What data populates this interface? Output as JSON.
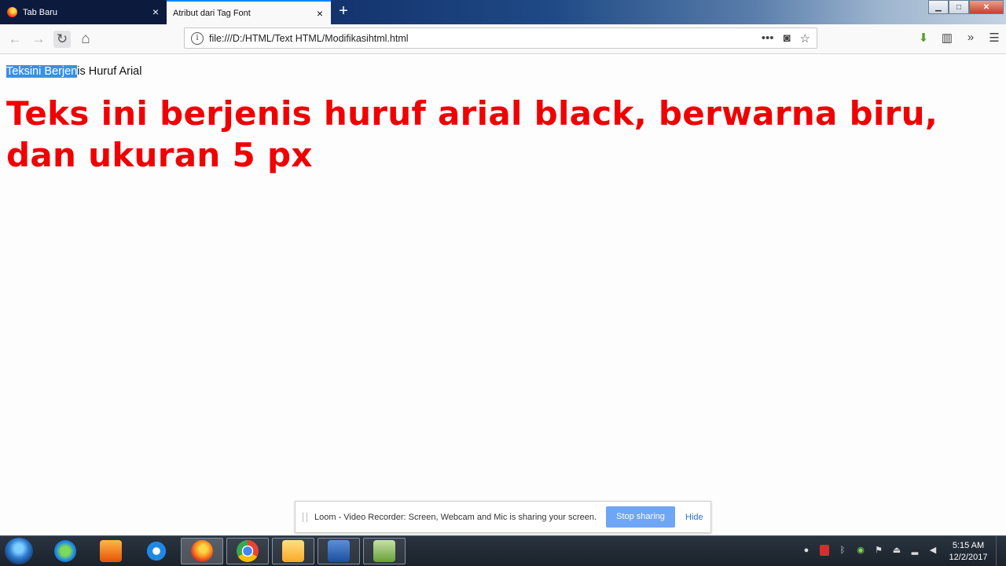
{
  "tabs": [
    {
      "title": "Tab Baru",
      "active": false
    },
    {
      "title": "Atribut dari Tag Font",
      "active": true
    }
  ],
  "icons": {
    "tab_close": "×",
    "new_tab": "+",
    "back": "←",
    "forward": "→",
    "reload": "↻",
    "home": "⌂",
    "more": "•••",
    "pocket": "◙",
    "bookmark": "☆",
    "download": "⬇",
    "library": "▥",
    "overflow": "»",
    "menu": "☰",
    "minimize": "▁",
    "maximize": "□",
    "close_window": "✕"
  },
  "navbar": {
    "url": "file:///D:/HTML/Text HTML/Modifikasihtml.html"
  },
  "page": {
    "selected_text": "Teksini Berjen",
    "rest_text": "is Huruf Arial",
    "heading": "Teks ini berjenis huruf arial black, berwarna biru, dan ukuran 5 px",
    "heading_color": "#f00000"
  },
  "loom": {
    "message": "Loom - Video Recorder: Screen, Webcam and Mic is sharing your screen.",
    "stop_label": "Stop sharing",
    "hide_label": "Hide"
  },
  "taskbar": {
    "apps": [
      "ie-download-manager",
      "media-player",
      "internet-explorer",
      "firefox",
      "chrome",
      "file-explorer",
      "word",
      "notepad-plus"
    ],
    "time": "5:15 AM",
    "date": "12/2/2017"
  }
}
